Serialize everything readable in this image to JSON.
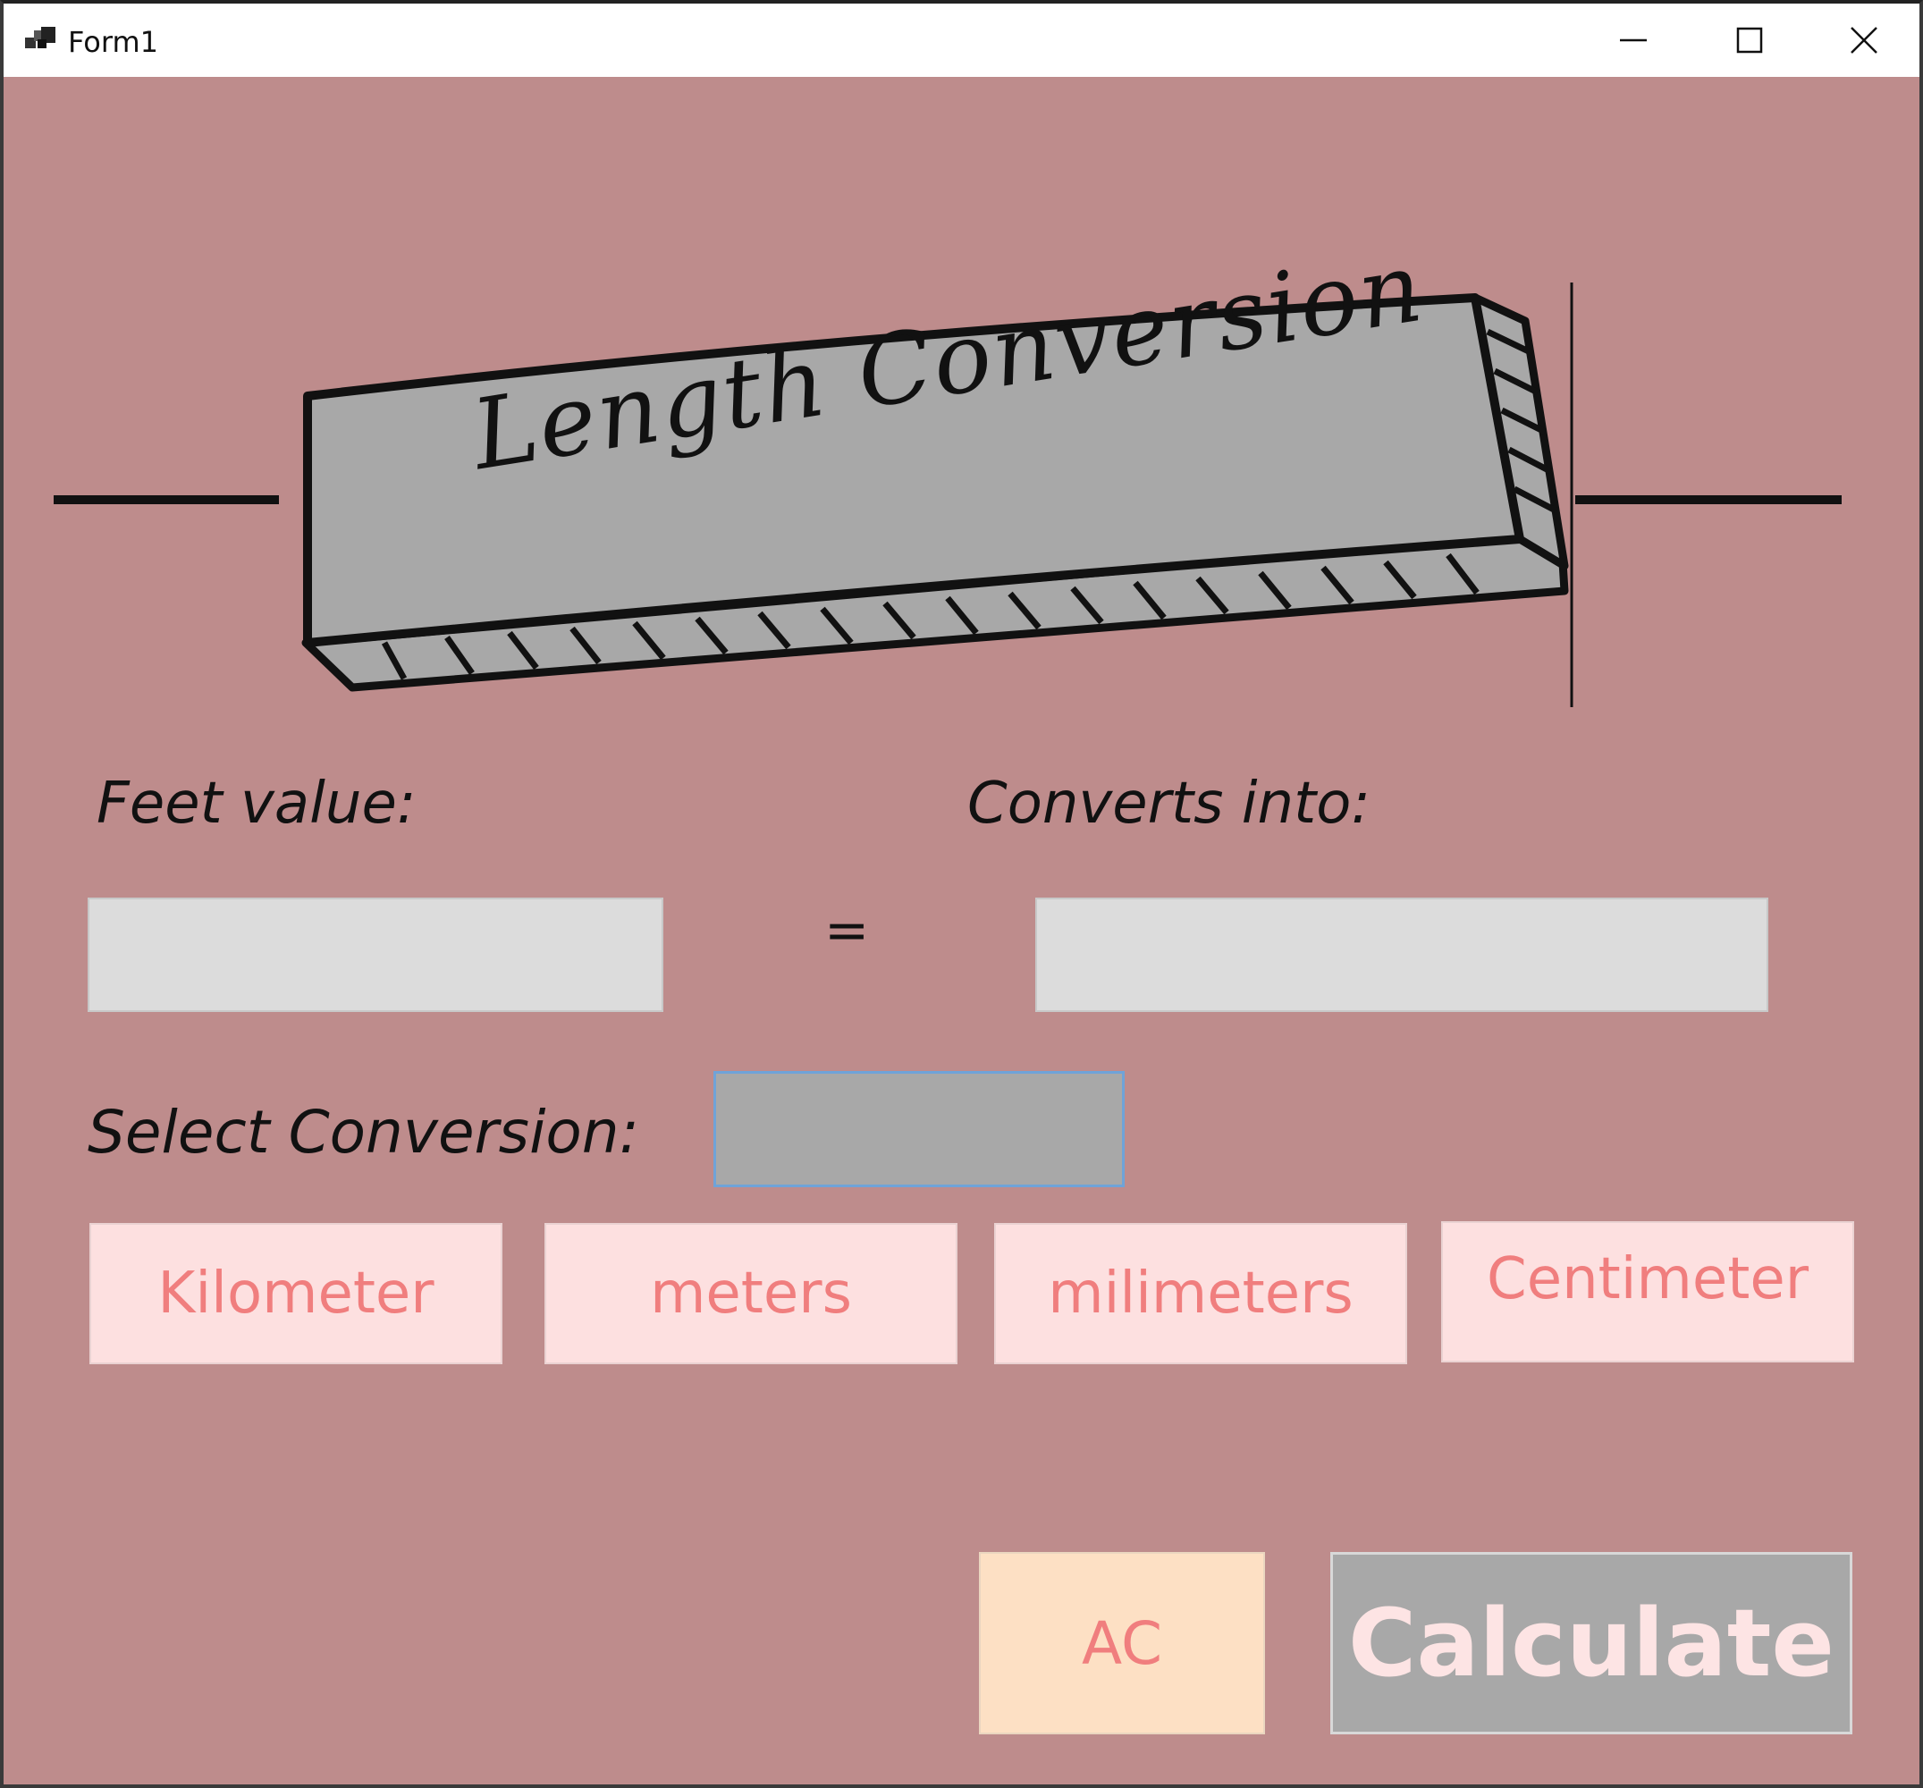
{
  "window": {
    "title": "Form1"
  },
  "banner": {
    "title": "Length Conversion"
  },
  "labels": {
    "feet_value": "Feet value:",
    "converts_into": "Converts into:",
    "equals": "=",
    "select_conversion": "Select Conversion:"
  },
  "inputs": {
    "feet_value": "",
    "result_value": "",
    "selected_conversion": ""
  },
  "unit_buttons": [
    {
      "label": "Kilometer"
    },
    {
      "label": "meters"
    },
    {
      "label": "milimeters"
    },
    {
      "label": "Centimeter"
    }
  ],
  "actions": {
    "clear_label": "AC",
    "calculate_label": "Calculate"
  },
  "icons": {
    "app": "app-window-icon",
    "minimize": "minimize-icon",
    "maximize": "maximize-icon",
    "close": "close-icon"
  },
  "colors": {
    "background": "#be8c8c",
    "unit_button_bg": "#fde0e0",
    "unit_button_text": "#f07e7e",
    "ac_button_bg": "#fde0c4",
    "calculate_button_bg": "#a8a8a8",
    "calculate_button_text": "#fde4e4",
    "textbox_bg": "#dcdcdc",
    "select_box_bg": "#a8a8a8",
    "banner_fill": "#a8a8a8"
  }
}
